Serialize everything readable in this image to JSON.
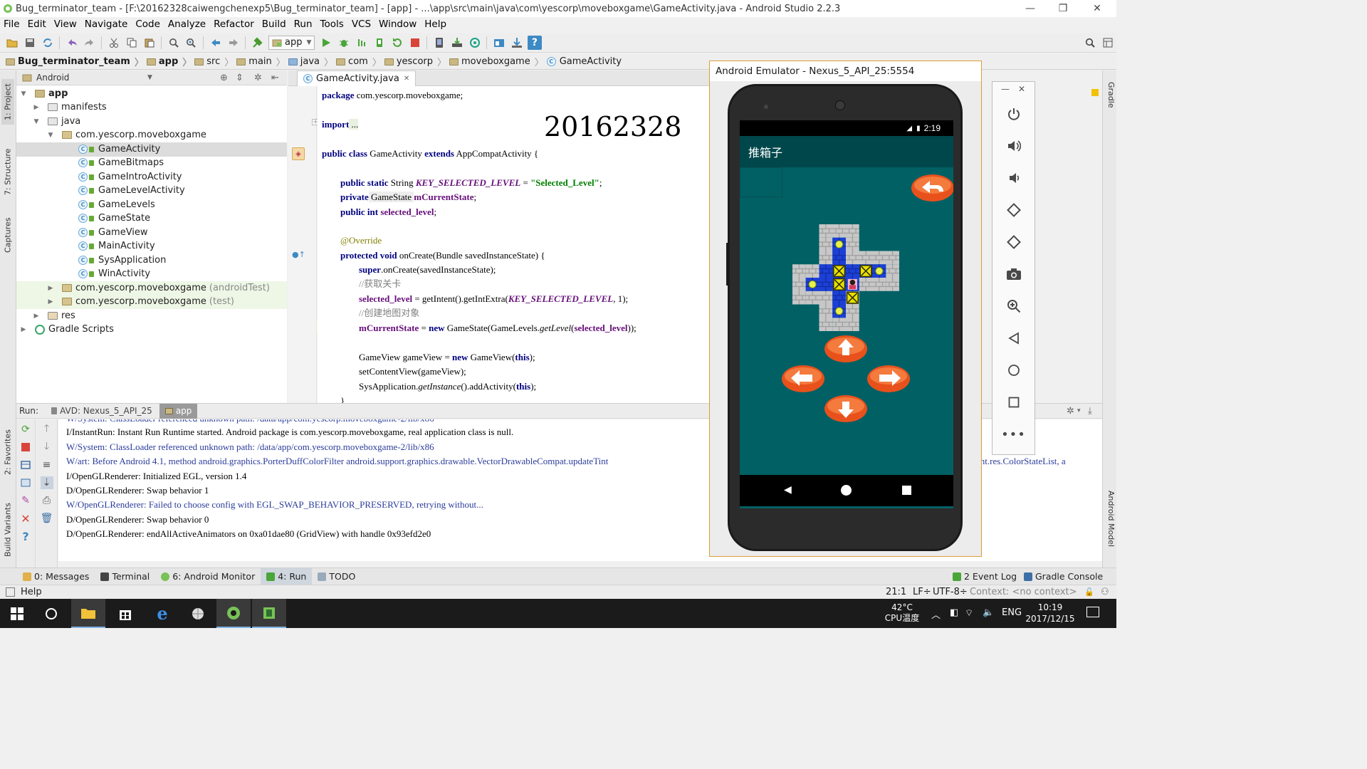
{
  "window": {
    "title": "Bug_terminator_team - [F:\\20162328caiwengchenexp5\\Bug_terminator_team] - [app] - ...\\app\\src\\main\\java\\com\\yescorp\\moveboxgame\\GameActivity.java - Android Studio 2.2.3",
    "controls": [
      "—",
      "❐",
      "✕"
    ]
  },
  "menu": [
    "File",
    "Edit",
    "View",
    "Navigate",
    "Code",
    "Analyze",
    "Refactor",
    "Build",
    "Run",
    "Tools",
    "VCS",
    "Window",
    "Help"
  ],
  "toolbar": {
    "run_config": "app"
  },
  "breadcrumbs": [
    "Bug_terminator_team",
    "app",
    "src",
    "main",
    "java",
    "com",
    "yescorp",
    "moveboxgame",
    "GameActivity"
  ],
  "left_strip": {
    "project": "1: Project",
    "structure": "7: Structure",
    "captures": "Captures",
    "favorites": "2: Favorites",
    "build_variants": "Build Variants"
  },
  "project_panel": {
    "view_mode": "Android",
    "tree": [
      {
        "label": "app",
        "suffix": ""
      },
      {
        "label": "manifests",
        "suffix": ""
      },
      {
        "label": "java",
        "suffix": ""
      },
      {
        "label": "com.yescorp.moveboxgame",
        "suffix": ""
      },
      {
        "label": "GameActivity",
        "suffix": ""
      },
      {
        "label": "GameBitmaps",
        "suffix": ""
      },
      {
        "label": "GameIntroActivity",
        "suffix": ""
      },
      {
        "label": "GameLevelActivity",
        "suffix": ""
      },
      {
        "label": "GameLevels",
        "suffix": ""
      },
      {
        "label": "GameState",
        "suffix": ""
      },
      {
        "label": "GameView",
        "suffix": ""
      },
      {
        "label": "MainActivity",
        "suffix": ""
      },
      {
        "label": "SysApplication",
        "suffix": ""
      },
      {
        "label": "WinActivity",
        "suffix": ""
      },
      {
        "label": "com.yescorp.moveboxgame",
        "suffix": "(androidTest)"
      },
      {
        "label": "com.yescorp.moveboxgame",
        "suffix": "(test)"
      },
      {
        "label": "res",
        "suffix": ""
      },
      {
        "label": "Gradle Scripts",
        "suffix": ""
      }
    ]
  },
  "editor": {
    "tab": "GameActivity.java",
    "tab_close": "✕",
    "handwriting": "20162328",
    "code": {
      "l1a": "package",
      "l1b": " com.yescorp.moveboxgame;",
      "l2a": "import",
      "l2b": " ...",
      "l3a": "public class",
      "l3b": " GameActivity ",
      "l3c": "extends",
      "l3d": " AppCompatActivity {",
      "l4a": "public static",
      "l4b": " String ",
      "l4c": "KEY_SELECTED_LEVEL",
      "l4d": " = ",
      "l4e": "\"Selected_Level\"",
      "l4f": ";",
      "l5a": "private",
      "l5b": " GameState ",
      "l5c": "mCurrentState",
      "l5d": ";",
      "l6a": "public int",
      "l6b": " ",
      "l6c": "selected_level",
      "l6d": ";",
      "l7": "@Override",
      "l8a": "protected void",
      "l8b": " onCreate(Bundle savedInstanceState) {",
      "l9a": "super",
      "l9b": ".onCreate(savedInstanceState);",
      "l10": "//获取关卡",
      "l11a": "selected_level",
      "l11b": " = getIntent().getIntExtra(",
      "l11c": "KEY_SELECTED_LEVEL",
      "l11d": ", 1);",
      "l12": "//创建地图对象",
      "l13a": "mCurrentState",
      "l13b": " = ",
      "l13c": "new",
      "l13d": " GameState(GameLevels.",
      "l13e": "getLevel",
      "l13f": "(",
      "l13g": "selected_level",
      "l13h": "));",
      "l14a": "GameView gameView = ",
      "l14b": "new",
      "l14c": " GameView(",
      "l14d": "this",
      "l14e": ");",
      "l15": "setContentView(gameView);",
      "l16a": "SysApplication.",
      "l16b": "getInstance",
      "l16c": "().addActivity(",
      "l16d": "this",
      "l16e": ");",
      "l17": "}"
    }
  },
  "run_panel": {
    "label": "Run:",
    "tab_avd": "AVD: Nexus_5_API_25",
    "tab_app": "app",
    "lines": [
      {
        "level": "w",
        "text": "W/System: ClassLoader referenced unknown path: /data/app/com.yescorp.moveboxgame-2/lib/x86"
      },
      {
        "level": "i",
        "text": "I/InstantRun: Instant Run Runtime started. Android package is com.yescorp.moveboxgame, real application class is null."
      },
      {
        "level": "w",
        "text": "W/System: ClassLoader referenced unknown path: /data/app/com.yescorp.moveboxgame-2/lib/x86"
      },
      {
        "level": "w",
        "text": "W/art: Before Android 4.1, method android.graphics.PorterDuffColorFilter android.support.graphics.drawable.VectorDrawableCompat.updateTint"
      },
      {
        "level": "i",
        "text": "I/OpenGLRenderer: Initialized EGL, version 1.4"
      },
      {
        "level": "i",
        "text": "D/OpenGLRenderer: Swap behavior 1"
      },
      {
        "level": "w",
        "text": "W/OpenGLRenderer: Failed to choose config with EGL_SWAP_BEHAVIOR_PRESERVED, retrying without..."
      },
      {
        "level": "i",
        "text": "D/OpenGLRenderer: Swap behavior 0"
      },
      {
        "level": "i",
        "text": "D/OpenGLRenderer: endAllActiveAnimators on 0xa01dae80 (GridView) with handle 0x93efd2e0"
      }
    ],
    "overflow_text": "ent.res.ColorStateList, a"
  },
  "bottom_tabs": {
    "messages": "0: Messages",
    "terminal": "Terminal",
    "android_monitor": "6: Android Monitor",
    "run": "4: Run",
    "todo": "TODO",
    "event_log": "2 Event Log",
    "gradle_console": "Gradle Console"
  },
  "right_strip": {
    "gradle": "Gradle",
    "android_model": "Android Model"
  },
  "status_bar": {
    "help": "Help",
    "position": "21:1",
    "line_sep": "LF÷",
    "encoding": "UTF-8÷",
    "context": "Context: <no context>"
  },
  "emulator": {
    "title": "Android Emulator - Nexus_5_API_25:5554",
    "time": "2:19",
    "app_title": "推箱子"
  },
  "taskbar": {
    "temp": "42°C",
    "temp_label": "CPU温度",
    "lang": "ENG",
    "time": "10:19",
    "date": "2017/12/15"
  },
  "colors": {
    "accent": "#3d8ac4",
    "emu_bg": "#006064",
    "emu_appbar": "#00474b",
    "emu_frame": "#d99d3a"
  }
}
